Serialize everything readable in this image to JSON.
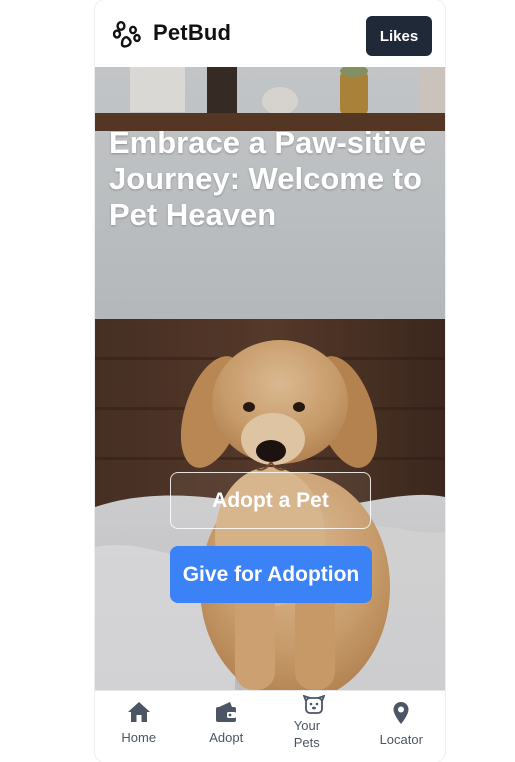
{
  "header": {
    "brand": "PetBud",
    "logo_icon": "paw-icon",
    "likes_label": "Likes"
  },
  "hero": {
    "title": "Embrace a Paw-sitive Journey: Welcome to Pet Heaven",
    "image": "golden-retriever-puppy-photo",
    "adopt_label": "Adopt a Pet",
    "give_label": "Give for Adoption"
  },
  "nav": {
    "items": [
      {
        "label": "Home",
        "icon": "home-icon"
      },
      {
        "label": "Adopt",
        "icon": "wallet-icon"
      },
      {
        "label": "Your Pets",
        "icon": "pet-face-icon"
      },
      {
        "label": "Locator",
        "icon": "map-pin-icon"
      }
    ]
  },
  "colors": {
    "primary": "#3b82f6",
    "dark_button": "#1f2937",
    "nav_text": "#4b5563"
  }
}
